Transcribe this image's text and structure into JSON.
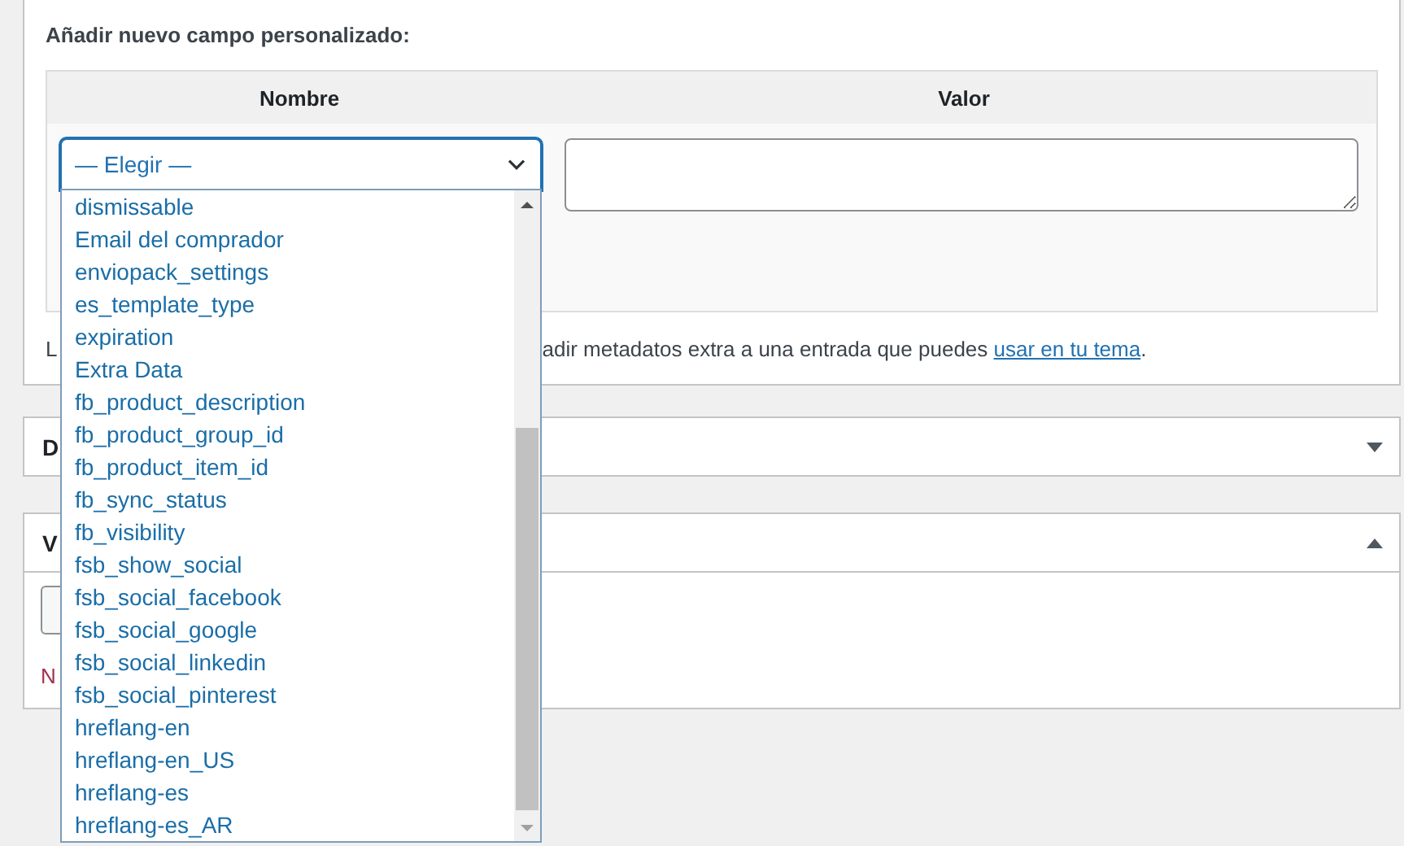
{
  "custom_fields": {
    "heading": "Añadir nuevo campo personalizado:",
    "columns": [
      "Nombre",
      "Valor"
    ],
    "name_select": {
      "value": "— Elegir —",
      "expanded": true,
      "options": [
        "dismissable",
        "Email del comprador",
        "enviopack_settings",
        "es_template_type",
        "expiration",
        "Extra Data",
        "fb_product_description",
        "fb_product_group_id",
        "fb_product_item_id",
        "fb_sync_status",
        "fb_visibility",
        "fsb_show_social",
        "fsb_social_facebook",
        "fsb_social_google",
        "fsb_social_linkedin",
        "fsb_social_pinterest",
        "hreflang-en",
        "hreflang-en_US",
        "hreflang-es",
        "hreflang-es_AR"
      ]
    },
    "description": {
      "start": "L",
      "end": "adir metadatos extra a una entrada que puedes ",
      "link": "usar en tu tema",
      "after": "."
    }
  },
  "panels": [
    {
      "title": "D",
      "expanded": false
    },
    {
      "title": "V",
      "expanded": true,
      "note": "N"
    }
  ]
}
